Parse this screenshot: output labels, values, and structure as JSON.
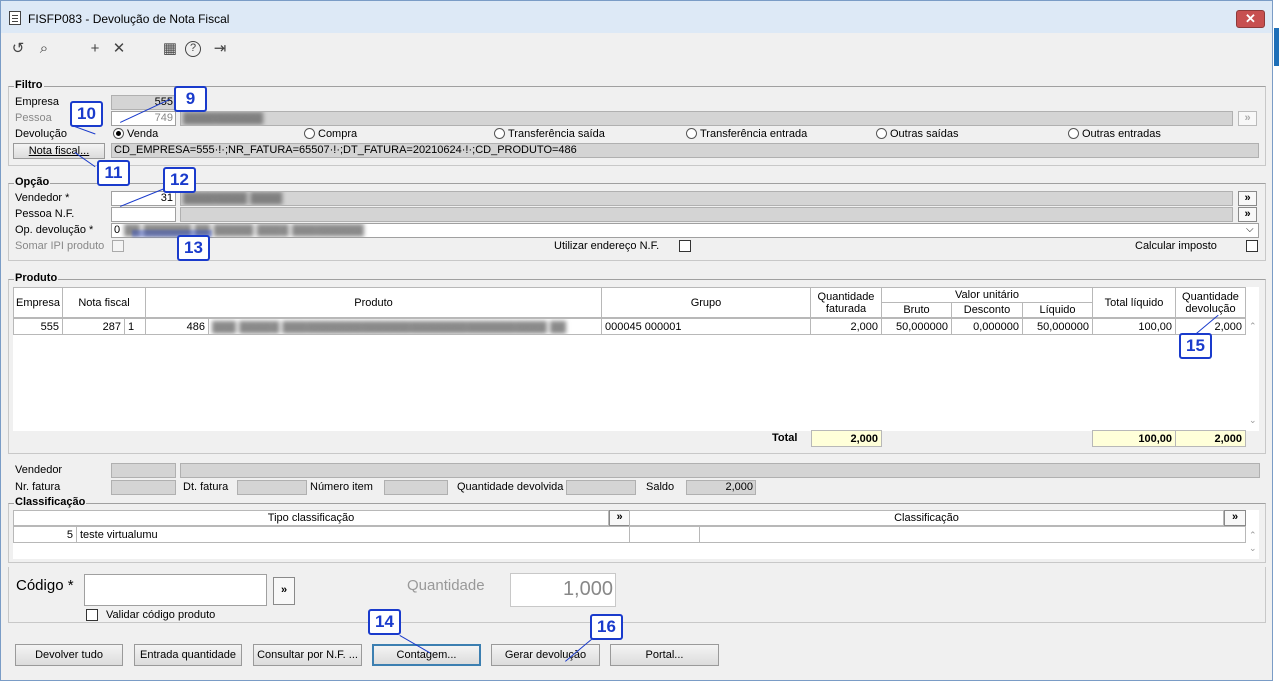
{
  "window": {
    "title": "FISFP083 - Devolução de Nota Fiscal",
    "close_label": "✕"
  },
  "toolbar": {
    "icons": [
      "refresh-icon",
      "search-icon",
      "add-icon",
      "delete-icon",
      "calendar-icon",
      "help-icon",
      "exit-icon"
    ],
    "glyphs": {
      "refresh": "↺",
      "search": "⌕",
      "add": "+",
      "delete": "✕",
      "calendar": "▦",
      "help": "?",
      "exit": "⇥"
    }
  },
  "filtro": {
    "title": "Filtro",
    "empresa_label": "Empresa",
    "empresa_value": "555",
    "pessoa_label": "Pessoa",
    "pessoa_value": "749",
    "devolucao_label": "Devolução",
    "radios": [
      "Venda",
      "Compra",
      "Transferência saída",
      "Transferência entrada",
      "Outras saídas",
      "Outras entradas"
    ],
    "selected_radio": "Venda",
    "nota_fiscal_button": "Nota fiscal...",
    "nota_fiscal_value": "CD_EMPRESA=555·!·;NR_FATURA=65507·!·;DT_FATURA=20210624·!·;CD_PRODUTO=486"
  },
  "opcao": {
    "title": "Opção",
    "vendedor_label": "Vendedor *",
    "vendedor_value": "31",
    "pessoa_nf_label": "Pessoa N.F.",
    "op_devolucao_label": "Op. devolução *",
    "op_devolucao_value": "0",
    "somar_ipi_label": "Somar IPI produto",
    "utilizar_endereco_label": "Utilizar endereço N.F.",
    "calcular_imposto_label": "Calcular imposto",
    "more_button": "»"
  },
  "produto": {
    "title": "Produto",
    "headers": {
      "empresa": "Empresa",
      "nota_fiscal": "Nota fiscal",
      "produto": "Produto",
      "grupo": "Grupo",
      "quantidade_faturada": "Quantidade faturada",
      "valor_unitario": "Valor unitário",
      "bruto": "Bruto",
      "desconto": "Desconto",
      "liquido": "Líquido",
      "total_liquido": "Total líquido",
      "quantidade_devolucao": "Quantidade devolução"
    },
    "rows": [
      {
        "empresa": "555",
        "nota_fiscal": "287",
        "item": "1",
        "produto_codigo": "486",
        "grupo": "000045 000001",
        "quantidade_faturada": "2,000",
        "bruto": "50,000000",
        "desconto": "0,000000",
        "liquido": "50,000000",
        "total_liquido": "100,00",
        "quantidade_devolucao": "2,000"
      }
    ],
    "total_label": "Total",
    "total_quantidade": "2,000",
    "total_liquido": "100,00",
    "total_devolucao": "2,000"
  },
  "detalhe": {
    "vendedor_label": "Vendedor",
    "nr_fatura_label": "Nr. fatura",
    "dt_fatura_label": "Dt. fatura",
    "numero_item_label": "Número item",
    "quantidade_devolvida_label": "Quantidade devolvida",
    "saldo_label": "Saldo",
    "saldo_value": "2,000"
  },
  "classificacao": {
    "title": "Classificação",
    "headers": {
      "tipo": "Tipo classificação",
      "classificacao": "Classificação"
    },
    "rows": [
      {
        "codigo": "5",
        "tipo": "teste virtualumu"
      }
    ]
  },
  "codigo": {
    "label": "Código *",
    "validar_label": "Validar código produto",
    "quantidade_label": "Quantidade",
    "quantidade_value": "1,000"
  },
  "buttons": {
    "devolver_tudo": "Devolver tudo",
    "entrada_quantidade": "Entrada quantidade",
    "consultar_nf": "Consultar por N.F. ...",
    "contagem": "Contagem...",
    "gerar_devolucao": "Gerar devolução",
    "portal": "Portal..."
  },
  "callouts": [
    "9",
    "10",
    "11",
    "12",
    "13",
    "14",
    "15",
    "16"
  ],
  "colors": {
    "callout": "#1a3bcc",
    "total_bg": "#ffffd9",
    "title_bg": "#dde9f6",
    "close": "#c75050"
  }
}
